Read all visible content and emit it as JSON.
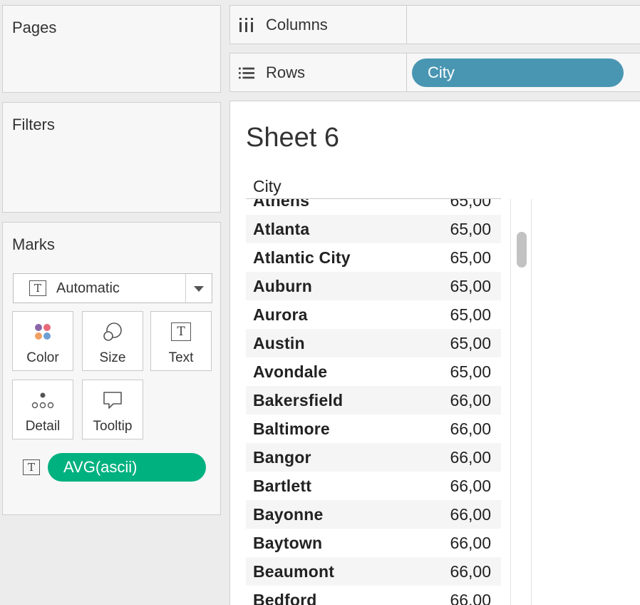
{
  "left_panel": {
    "pages_title": "Pages",
    "filters_title": "Filters",
    "marks_title": "Marks",
    "mark_type": "Automatic",
    "mark_buttons": {
      "color": "Color",
      "size": "Size",
      "text": "Text",
      "detail": "Detail",
      "tooltip": "Tooltip"
    },
    "text_pill": "AVG(ascii)",
    "text_pill_color": "#00b180",
    "t_glyph": "T"
  },
  "shelves": {
    "columns_label": "Columns",
    "rows_label": "Rows",
    "rows_pill": "City",
    "rows_pill_color": "#4996b2"
  },
  "sheet": {
    "title": "Sheet 6",
    "column_header": "City",
    "rows": [
      {
        "city": "Athens",
        "value": "65,00"
      },
      {
        "city": "Atlanta",
        "value": "65,00"
      },
      {
        "city": "Atlantic City",
        "value": "65,00"
      },
      {
        "city": "Auburn",
        "value": "65,00"
      },
      {
        "city": "Aurora",
        "value": "65,00"
      },
      {
        "city": "Austin",
        "value": "65,00"
      },
      {
        "city": "Avondale",
        "value": "65,00"
      },
      {
        "city": "Bakersfield",
        "value": "66,00"
      },
      {
        "city": "Baltimore",
        "value": "66,00"
      },
      {
        "city": "Bangor",
        "value": "66,00"
      },
      {
        "city": "Bartlett",
        "value": "66,00"
      },
      {
        "city": "Bayonne",
        "value": "66,00"
      },
      {
        "city": "Baytown",
        "value": "66,00"
      },
      {
        "city": "Beaumont",
        "value": "66,00"
      },
      {
        "city": "Bedford",
        "value": "66,00"
      }
    ]
  }
}
